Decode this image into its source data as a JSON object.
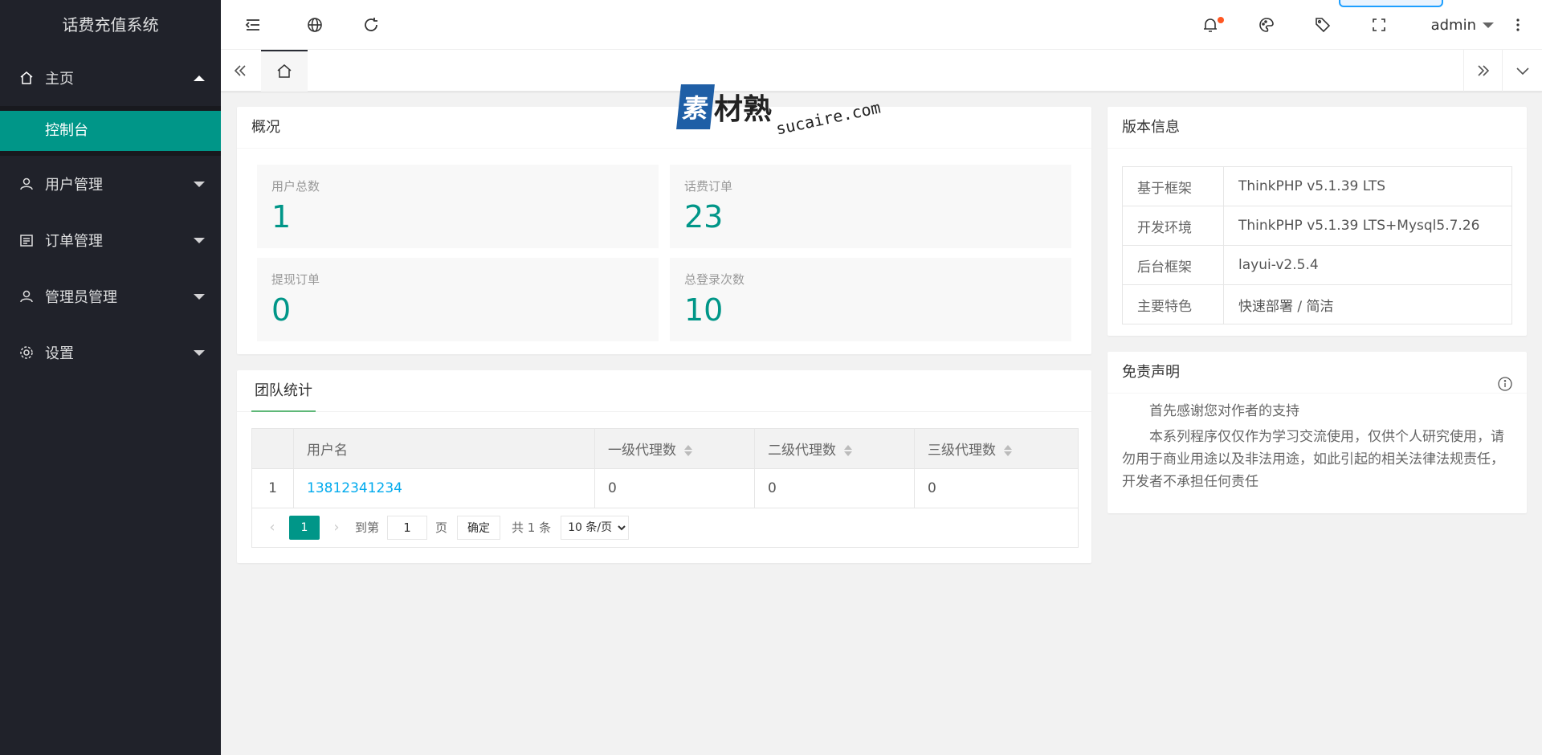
{
  "app": {
    "title": "话费充值系统"
  },
  "sidebar": {
    "items": [
      {
        "label": "主页",
        "icon": "home-icon",
        "expanded": true,
        "children": [
          {
            "label": "控制台",
            "active": true
          }
        ]
      },
      {
        "label": "用户管理",
        "icon": "user-icon"
      },
      {
        "label": "订单管理",
        "icon": "order-icon"
      },
      {
        "label": "管理员管理",
        "icon": "admin-icon"
      },
      {
        "label": "设置",
        "icon": "gear-icon"
      }
    ]
  },
  "header": {
    "user": "admin",
    "icons": [
      "menu-toggle-icon",
      "globe-icon",
      "refresh-icon",
      "bell-icon",
      "theme-icon",
      "tag-icon",
      "fullscreen-icon",
      "more-icon"
    ]
  },
  "overview": {
    "title": "概况",
    "stats": [
      {
        "label": "用户总数",
        "value": "1"
      },
      {
        "label": "话费订单",
        "value": "23"
      },
      {
        "label": "提现订单",
        "value": "0"
      },
      {
        "label": "总登录次数",
        "value": "10"
      }
    ]
  },
  "version": {
    "title": "版本信息",
    "rows": [
      {
        "key": "基于框架",
        "value": "ThinkPHP v5.1.39 LTS"
      },
      {
        "key": "开发环境",
        "value": "ThinkPHP v5.1.39 LTS+Mysql5.7.26"
      },
      {
        "key": "后台框架",
        "value": "layui-v2.5.4"
      },
      {
        "key": "主要特色",
        "value": "快速部署 / 简洁"
      }
    ]
  },
  "team": {
    "title": "团队统计",
    "columns": [
      "用户名",
      "一级代理数",
      "二级代理数",
      "三级代理数"
    ],
    "rows": [
      {
        "index": "1",
        "username": "13812341234",
        "l1": "0",
        "l2": "0",
        "l3": "0"
      }
    ],
    "pager": {
      "current": "1",
      "goto_label": "到第",
      "goto_value": "1",
      "page_label": "页",
      "confirm": "确定",
      "total": "共 1 条",
      "per_page": "10 条/页"
    }
  },
  "disclaimer": {
    "title": "免责声明",
    "paragraphs": [
      "首先感谢您对作者的支持",
      "本系列程序仅仅作为学习交流使用，仅供个人研究使用，请勿用于商业用途以及非法用途，如此引起的相关法律法规责任，开发者不承担任何责任"
    ]
  },
  "watermark": {
    "box": "素",
    "cn": "材熟",
    "en": "sucaire.com"
  },
  "colors": {
    "accent": "#009688",
    "sidebar": "#20222a",
    "link": "#01aaed",
    "notice": "#ff5722"
  }
}
